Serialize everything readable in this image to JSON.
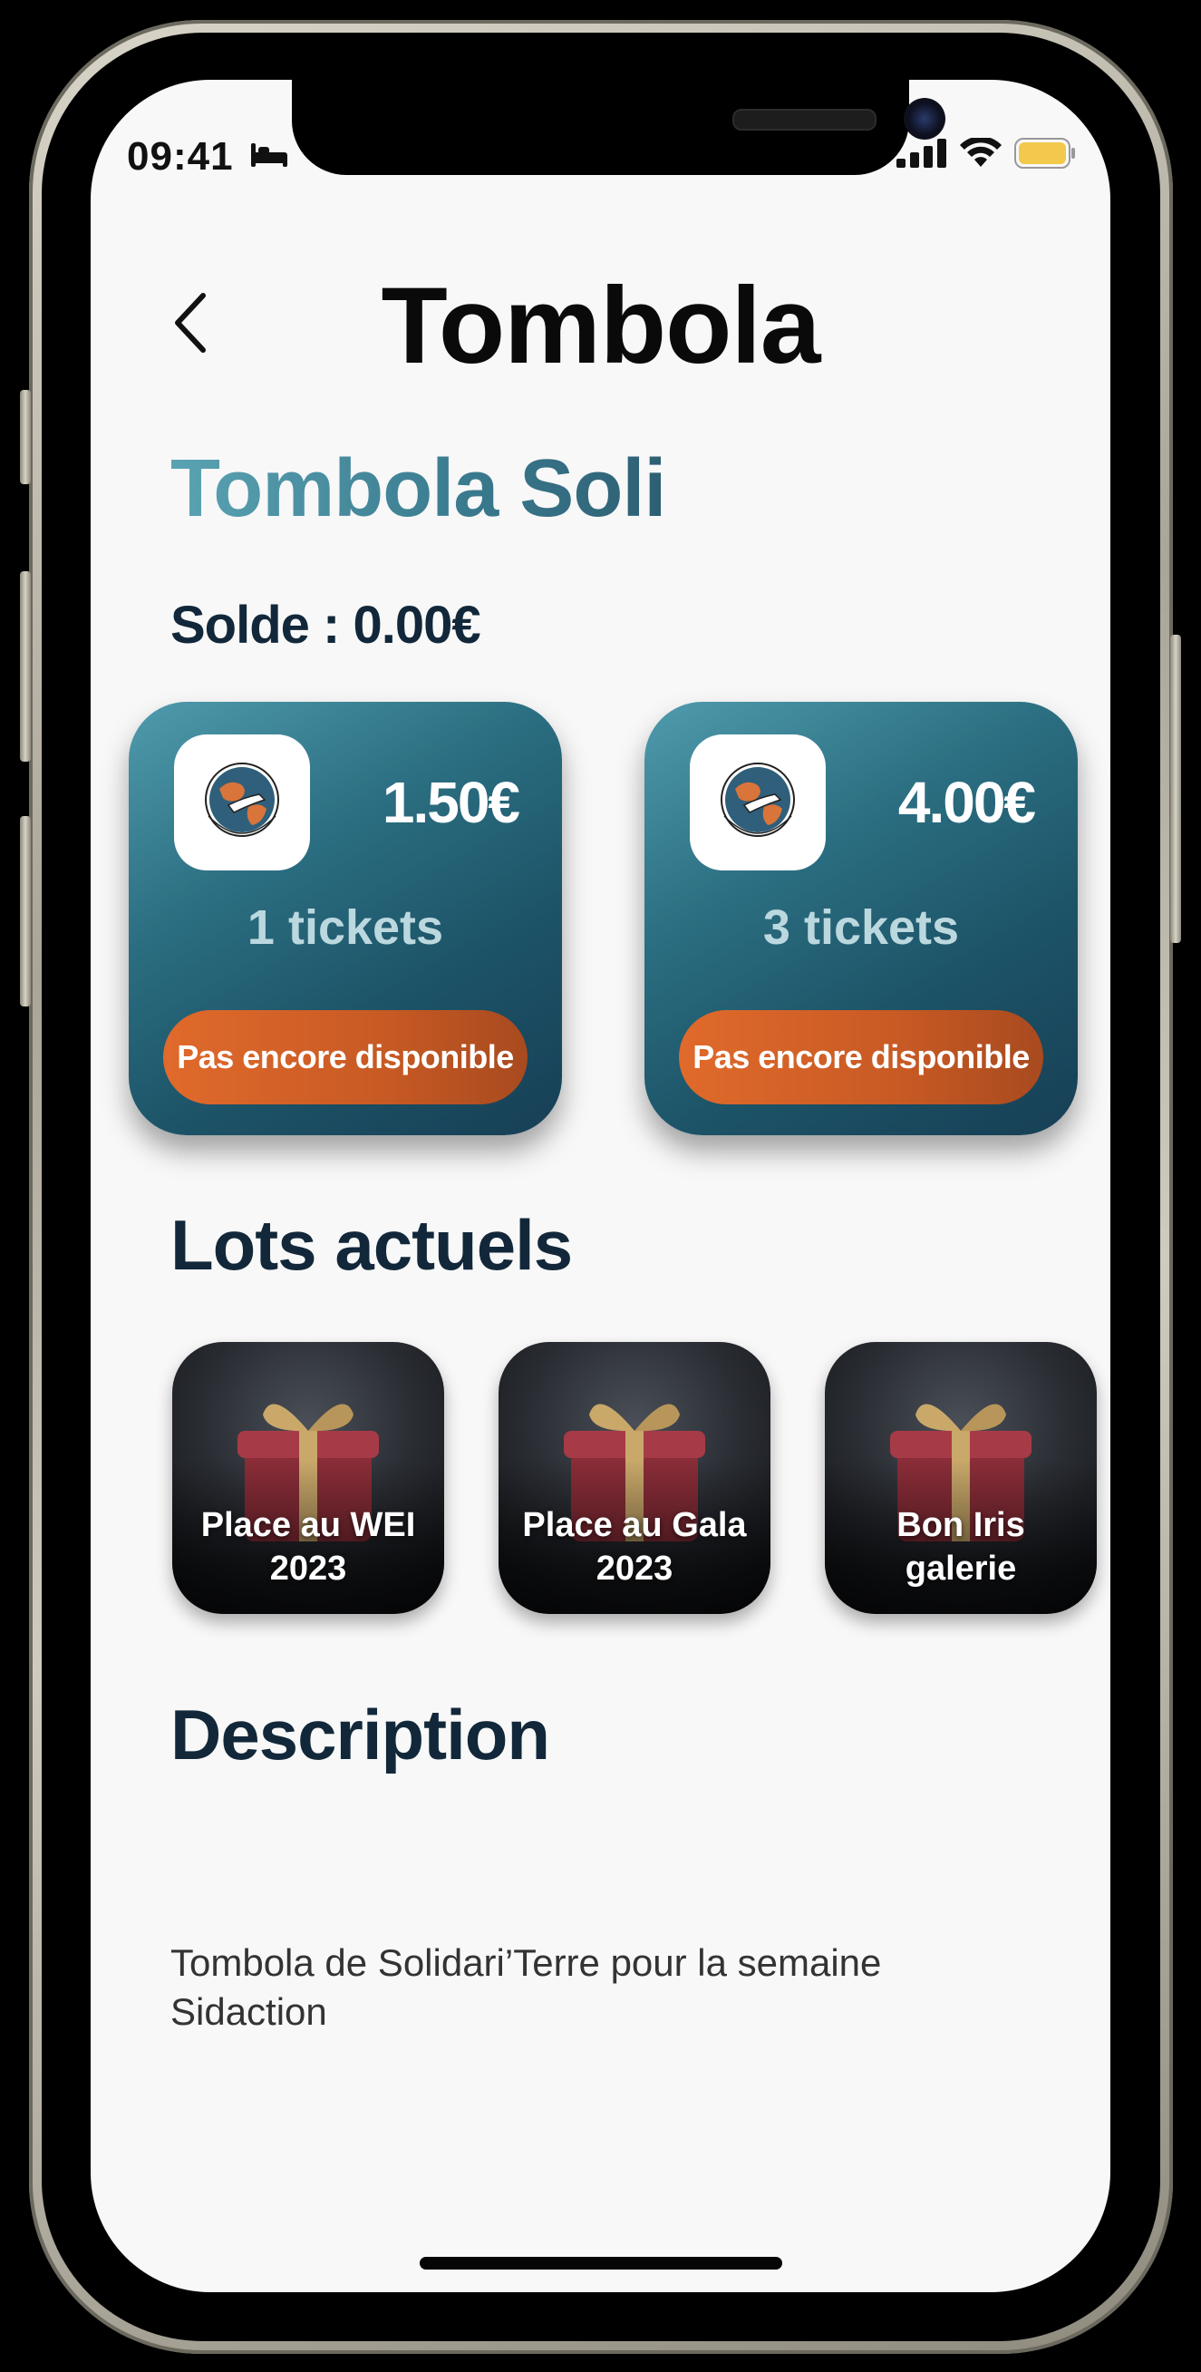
{
  "status_bar": {
    "time": "09:41"
  },
  "header": {
    "title": "Tombola"
  },
  "raffle": {
    "name": "Tombola Soli",
    "balance": "Solde : 0.00€"
  },
  "ticket_packs": [
    {
      "price": "1.50€",
      "tickets": "1 tickets",
      "button_label": "Pas encore disponible",
      "logo_text": "SOLIDARI'TERRE"
    },
    {
      "price": "4.00€",
      "tickets": "3 tickets",
      "button_label": "Pas encore disponible",
      "logo_text": "SOLIDARI'TERRE"
    }
  ],
  "prizes": {
    "title": "Lots actuels",
    "items": [
      {
        "label_line1": "Place au WEI",
        "label_line2": "2023"
      },
      {
        "label_line1": "Place au Gala",
        "label_line2": "2023"
      },
      {
        "label_line1": "Bon Iris",
        "label_line2": "galerie"
      }
    ]
  },
  "description": {
    "title": "Description",
    "text": "Tombola de Solidari’Terre pour la semaine Sidaction"
  },
  "colors": {
    "accent_teal": "#2c6f82",
    "accent_orange": "#e06a2b",
    "heading_dark": "#12283a"
  }
}
